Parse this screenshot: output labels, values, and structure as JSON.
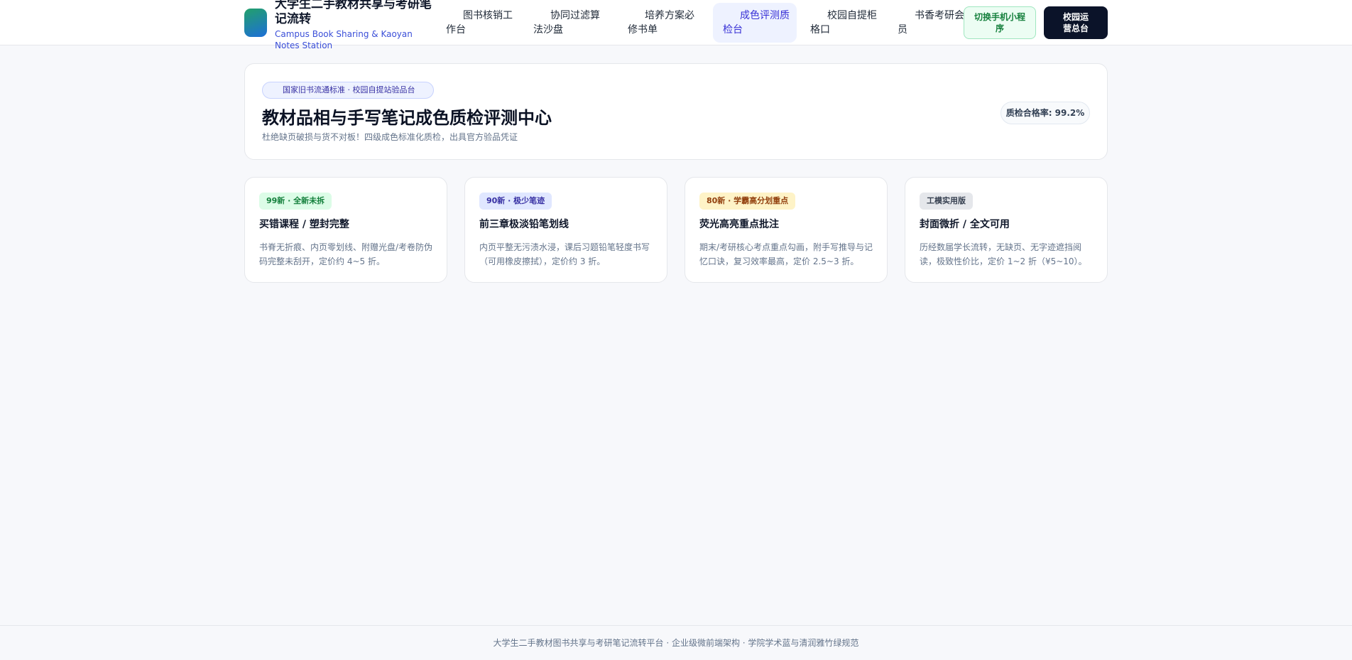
{
  "header": {
    "title": "大学生二手教材共享与考研笔记流转",
    "subtitle": "Campus Book Sharing & Kaoyan Notes Station",
    "nav": [
      {
        "label": "图书核销工作台"
      },
      {
        "label": "协同过滤算法沙盘"
      },
      {
        "label": "培养方案必修书单"
      },
      {
        "label": "成色评测质检台",
        "active": true
      },
      {
        "label": "校园自提柜格口"
      },
      {
        "label": "书香考研会员"
      }
    ],
    "mini_program_label": "切换手机小程序",
    "ops_label": "校园运营总台"
  },
  "hero": {
    "pill": "国家旧书流通标准 · 校园自提站验品台",
    "title": "教材品相与手写笔记成色质检评测中心",
    "description": "杜绝缺页破损与货不对板！四级成色标准化质检，出具官方验品凭证",
    "stat": "质检合格率: 99.2%"
  },
  "grades": [
    {
      "badge": "99新 · 全新未拆",
      "badge_bg": "#dcfce7",
      "badge_fg": "#15803d",
      "title": "买错课程 / 塑封完整",
      "description": "书脊无折痕、内页零划线、附赠光盘/考卷防伪码完整未刮开，定价约 4~5 折。"
    },
    {
      "badge": "90新 · 极少笔迹",
      "badge_bg": "#e0e7ff",
      "badge_fg": "#3730a3",
      "title": "前三章极淡铅笔划线",
      "description": "内页平整无污渍水浸，课后习题铅笔轻度书写（可用橡皮擦拭），定价约 3 折。"
    },
    {
      "badge": "80新 · 学霸高分划重点",
      "badge_bg": "#fef3c7",
      "badge_fg": "#92400e",
      "title": "荧光高亮重点批注",
      "description": "期末/考研核心考点重点勾画，附手写推导与记忆口诀，复习效率最高，定价 2.5~3 折。"
    },
    {
      "badge": "工模实用版",
      "badge_bg": "#e5e7eb",
      "badge_fg": "#374151",
      "title": "封面微折 / 全文可用",
      "description": "历经数届学长流转，无缺页、无字迹遮挡阅读，极致性价比，定价 1~2 折（¥5~10）。"
    }
  ],
  "footer": {
    "text": "大学生二手教材图书共享与考研笔记流转平台 · 企业级微前端架构 · 学院学术蓝与清润雅竹绿规范"
  }
}
